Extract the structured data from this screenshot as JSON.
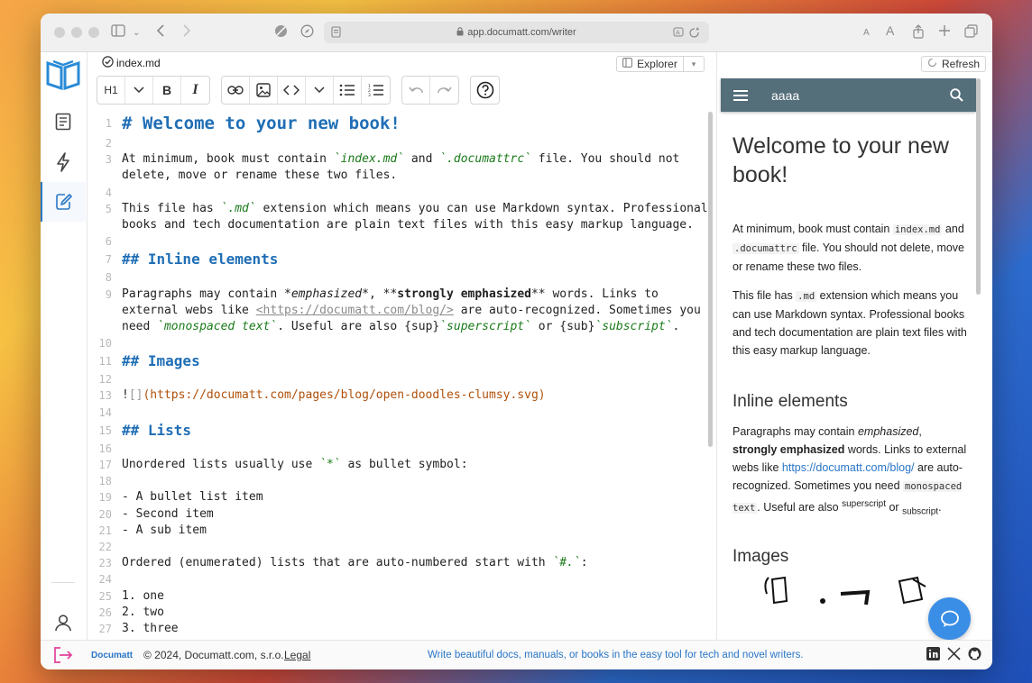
{
  "browser": {
    "url": "app.documatt.com/writer"
  },
  "editor": {
    "file_name": "index.md",
    "explorer_label": "Explorer",
    "heading_label": "H1",
    "lines": [
      {
        "n": "1"
      },
      {
        "n": "2"
      },
      {
        "n": "3"
      },
      {
        "n": "4"
      },
      {
        "n": "5"
      },
      {
        "n": "6"
      },
      {
        "n": "7"
      },
      {
        "n": "8"
      },
      {
        "n": "9"
      },
      {
        "n": "10"
      },
      {
        "n": "11"
      },
      {
        "n": "12"
      },
      {
        "n": "13"
      },
      {
        "n": "14"
      },
      {
        "n": "15"
      },
      {
        "n": "16"
      },
      {
        "n": "17"
      },
      {
        "n": "18"
      },
      {
        "n": "19"
      },
      {
        "n": "20"
      },
      {
        "n": "21"
      },
      {
        "n": "22"
      },
      {
        "n": "23"
      },
      {
        "n": "24"
      },
      {
        "n": "25"
      },
      {
        "n": "26"
      },
      {
        "n": "27"
      }
    ],
    "text": {
      "l1": "# Welcome to your new book!",
      "l3a": "At minimum, book must contain ",
      "l3b": "`index.md`",
      "l3c": " and ",
      "l3d": "`.documattrc`",
      "l3e": " file. You should not",
      "l3cont": "delete, move or rename these two files.",
      "l5a": "This file has ",
      "l5b": "`.md`",
      "l5c": " extension which means you can use Markdown syntax. Professional",
      "l5cont": "books and tech documentation are plain text files with this easy markup language.",
      "l7": "## Inline elements",
      "l9a": "Paragraphs may contain *",
      "l9b": "emphasized",
      "l9c": "*, **",
      "l9d": "strongly emphasized",
      "l9e": "** words. Links to",
      "l9cont1a": "external webs like ",
      "l9cont1b": "<https://documatt.com/blog/>",
      "l9cont1c": " are auto-recognized. Sometimes you",
      "l9cont2a": "need ",
      "l9cont2b": "`monospaced text`",
      "l9cont2c": ". Useful are also {sup}",
      "l9cont2d": "`superscript`",
      "l9cont2e": " or {sub}",
      "l9cont2f": "`subscript`",
      "l9cont2g": ".",
      "l11": "## Images",
      "l13a": "!",
      "l13b": "[]",
      "l13c": "(https://documatt.com/pages/blog/open-doodles-clumsy.svg)",
      "l15": "## Lists",
      "l17a": "Unordered lists usually use ",
      "l17b": "`*`",
      "l17c": " as bullet symbol:",
      "l19": "- A bullet list item",
      "l20": "- Second item",
      "l21": "- A sub item",
      "l23a": "Ordered (enumerated) lists that are auto-numbered start with ",
      "l23b": "`#.`",
      "l23c": ":",
      "l25": "1. one",
      "l26": "2. two",
      "l27": "3. three"
    }
  },
  "preview": {
    "refresh_label": "Refresh",
    "header_title": "aaaa",
    "h1": "Welcome to your new book!",
    "p1a": "At minimum, book must contain ",
    "p1b": "index.md",
    "p1c": " and ",
    "p1d": ".documattrc",
    "p1e": " file. You should not delete, move or rename these two files.",
    "p2a": "This file has ",
    "p2b": ".md",
    "p2c": " extension which means you can use Markdown syntax. Professional books and tech documentation are plain text files with this easy markup language.",
    "h2a": "Inline elements",
    "p3a": "Paragraphs may contain ",
    "p3b": "emphasized",
    "p3c": ", ",
    "p3d": "strongly emphasized",
    "p3e": " words. Links to external webs like ",
    "p3f": "https://documatt.com/blog/",
    "p3g": " are auto-recognized. Sometimes you need ",
    "p3h": "monospaced text",
    "p3i": ". Useful are also ",
    "p3j": "superscript",
    "p3k": " or ",
    "p3l": "subscript",
    "p3m": ".",
    "h2b": "Images"
  },
  "footer": {
    "brand": "Documatt",
    "copyright": "© 2024, Documatt.com, s.r.o.",
    "legal": "Legal",
    "tagline": "Write beautiful docs, manuals, or books in the easy tool for tech and novel writers."
  },
  "colors": {
    "accent": "#2978c7",
    "heading_blue": "#1f6eb5",
    "preview_header": "#546e7a",
    "help_bubble": "#3a8ee6"
  }
}
